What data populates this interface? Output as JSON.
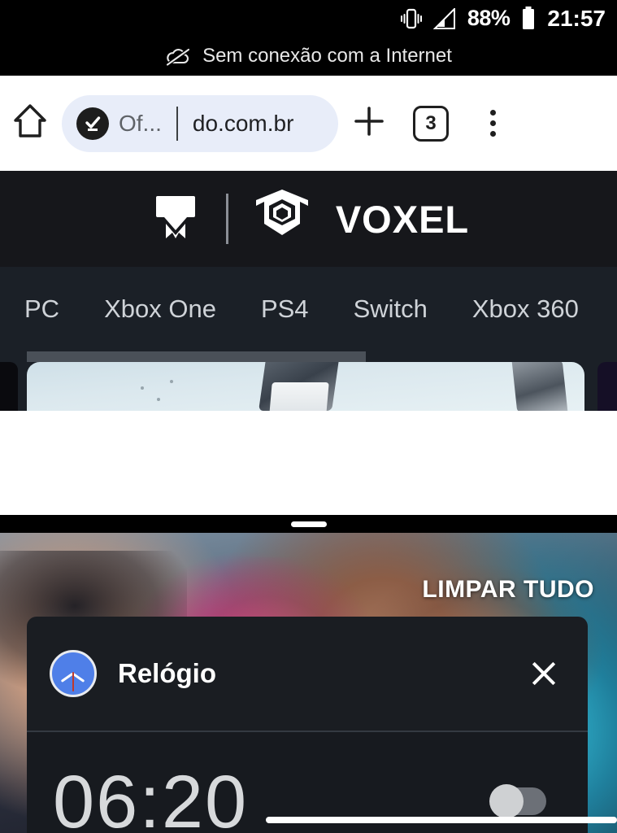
{
  "status_bar": {
    "vibrate_icon": "vibrate-icon",
    "signal_icon": "signal-bars-icon",
    "battery_percent": "88%",
    "battery_icon": "battery-icon",
    "clock": "21:57"
  },
  "offline_notice": {
    "icon": "cloud-off-icon",
    "text": "Sem conexão com a Internet"
  },
  "browser": {
    "home_icon": "home-icon",
    "site_badge_icon": "verified-check-icon",
    "url_prefix": "Of...",
    "url_text": "do.com.br",
    "new_tab_icon": "plus-icon",
    "tab_count": "3",
    "menu_icon": "more-vertical-icon"
  },
  "site": {
    "brand_mark": "uol-jogos-logo",
    "voxel_mark": "voxel-cube-icon",
    "voxel_wordmark": "VOXEL",
    "nav": [
      {
        "label": "PC"
      },
      {
        "label": "Xbox One"
      },
      {
        "label": "PS4"
      },
      {
        "label": "Switch"
      },
      {
        "label": "Xbox 360"
      }
    ]
  },
  "recents": {
    "drag_handle": "drag-handle",
    "clear_all_label": "LIMPAR TUDO",
    "cards": [
      {
        "app_name": "Relógio",
        "app_icon": "clock-icon",
        "close_icon": "close-icon",
        "content_time": "06:20"
      }
    ]
  },
  "navigation": {
    "gesture_bar": "gesture-home-bar",
    "pointer": "touch-pointer-indicator"
  },
  "colors": {
    "status_bar_bg": "#000000",
    "browser_bg": "#ffffff",
    "url_pill_bg": "#e8edf9",
    "site_header_bg": "#16171b",
    "site_nav_bg": "#1b2027",
    "card_bg": "#1a1d22",
    "accent_blue": "#4f7fe8"
  }
}
